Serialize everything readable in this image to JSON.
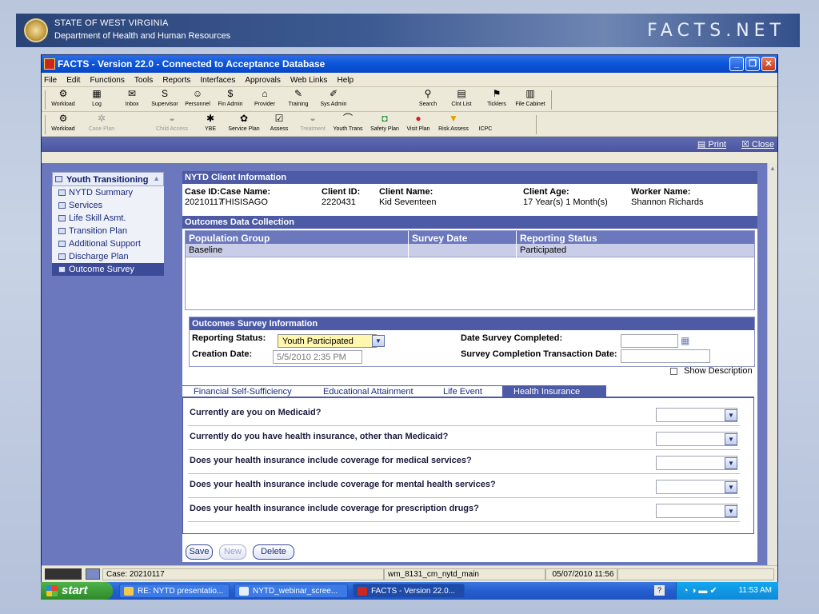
{
  "banner": {
    "line1": "STATE OF WEST VIRGINIA",
    "line2": "Department of Health and Human Resources",
    "brand": "FACTS.NET"
  },
  "window": {
    "title": "FACTS - Version 22.0 - Connected to Acceptance Database",
    "min": "_",
    "max": "❐",
    "close": "✕"
  },
  "menu": [
    "File",
    "Edit",
    "Functions",
    "Tools",
    "Reports",
    "Interfaces",
    "Approvals",
    "Web Links",
    "Help"
  ],
  "toolbar1": [
    {
      "label": "Workload",
      "icon": "⚙"
    },
    {
      "label": "Log",
      "icon": "▦"
    },
    {
      "label": "Inbox",
      "icon": "✉"
    },
    {
      "label": "Supervisor",
      "icon": "S"
    },
    {
      "label": "Personnel",
      "icon": "☺"
    },
    {
      "label": "Fin Admin",
      "icon": "$"
    },
    {
      "label": "Provider",
      "icon": "⌂"
    },
    {
      "label": "Training",
      "icon": "✎"
    },
    {
      "label": "Sys Admin",
      "icon": "✐"
    },
    {
      "label": "Search",
      "icon": "⚲"
    },
    {
      "label": "Clnt List",
      "icon": "▤"
    },
    {
      "label": "Ticklers",
      "icon": "⚑"
    },
    {
      "label": "File Cabinet",
      "icon": "▥"
    }
  ],
  "toolbar2": [
    {
      "label": "Workload",
      "icon": "⚙"
    },
    {
      "label": "Case Plan",
      "icon": "✲"
    },
    {
      "label": "Child Access",
      "icon": "◒"
    },
    {
      "label": "YBE",
      "icon": "✱"
    },
    {
      "label": "Service Plan",
      "icon": "✿"
    },
    {
      "label": "Assess",
      "icon": "☑"
    },
    {
      "label": "Treatment",
      "icon": "◒"
    },
    {
      "label": "Youth Trans",
      "icon": "⌒"
    },
    {
      "label": "Safety Plan",
      "icon": "◘"
    },
    {
      "label": "Visit Plan",
      "icon": "●"
    },
    {
      "label": "Risk Assess",
      "icon": "▼"
    },
    {
      "label": "ICPC",
      "icon": ""
    }
  ],
  "content_head": {
    "print": "Print",
    "close": "Close"
  },
  "sidebar": {
    "header": "Youth Transitioning",
    "items": [
      {
        "label": "NYTD Summary"
      },
      {
        "label": "Services"
      },
      {
        "label": "Life Skill Asmt."
      },
      {
        "label": "Transition Plan"
      },
      {
        "label": "Additional Support"
      },
      {
        "label": "Discharge Plan"
      },
      {
        "label": "Outcome Survey"
      }
    ]
  },
  "client_info": {
    "section_title": "NYTD Client Information",
    "case_id_label": "Case ID:",
    "case_id": "20210117",
    "case_name_label": "Case Name:",
    "case_name": "THISISAGO",
    "client_id_label": "Client ID:",
    "client_id": "2220431",
    "client_name_label": "Client Name:",
    "client_name": "Kid Seventeen",
    "client_age_label": "Client Age:",
    "client_age": "17 Year(s) 1 Month(s)",
    "worker_name_label": "Worker Name:",
    "worker_name": "Shannon Richards"
  },
  "outcomes": {
    "section_title": "Outcomes Data Collection",
    "columns": [
      "Population Group",
      "Survey Date",
      "Reporting Status"
    ],
    "rows": [
      {
        "population_group": "Baseline",
        "survey_date": "",
        "reporting_status": "Participated"
      }
    ]
  },
  "survey_info": {
    "section_title": "Outcomes Survey Information",
    "reporting_status_label": "Reporting Status:",
    "reporting_status_value": "Youth Participated",
    "creation_date_label": "Creation Date:",
    "creation_date_value": "5/5/2010 2:35 PM",
    "date_completed_label": "Date Survey Completed:",
    "date_completed_value": "",
    "transaction_date_label": "Survey Completion Transaction Date:",
    "transaction_date_value": "",
    "show_description": "Show Description"
  },
  "tabs": [
    {
      "label": "Financial Self-Sufficiency"
    },
    {
      "label": "Educational Attainment"
    },
    {
      "label": "Life Event"
    },
    {
      "label": "Health Insurance"
    }
  ],
  "questions": [
    {
      "text": "Currently are you on Medicaid?",
      "value": ""
    },
    {
      "text": "Currently do you have health insurance, other than Medicaid?",
      "value": ""
    },
    {
      "text": "Does your health insurance include coverage for medical services?",
      "value": ""
    },
    {
      "text": "Does your health insurance include coverage for mental health services?",
      "value": ""
    },
    {
      "text": "Does your health insurance include coverage for prescription drugs?",
      "value": ""
    }
  ],
  "buttons": {
    "save": "Save",
    "new": "New",
    "delete": "Delete"
  },
  "statusbar": {
    "case": "Case: 20210117",
    "window_id": "wm_8131_cm_nytd_main",
    "datetime": "05/07/2010 11:56"
  },
  "taskbar": {
    "start": "start",
    "tasks": [
      {
        "label": "RE: NYTD presentatio..."
      },
      {
        "label": "NYTD_webinar_scree..."
      },
      {
        "label": "FACTS - Version 22.0..."
      }
    ],
    "clock": "11:53 AM"
  }
}
